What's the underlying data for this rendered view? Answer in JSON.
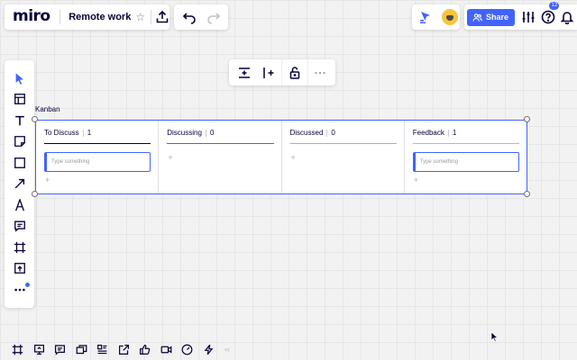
{
  "topbar": {
    "logo": "miro",
    "board_title": "Remote work",
    "star": "☆",
    "share_label": "Share",
    "notifications_count": "12"
  },
  "kanban": {
    "label": "Kanban",
    "columns": [
      {
        "title": "To Discuss",
        "count": "1",
        "color": "#050038",
        "cards": [
          "Type something"
        ]
      },
      {
        "title": "Discussing",
        "count": "0",
        "color": "#4262ff",
        "cards": []
      },
      {
        "title": "Discussed",
        "count": "0",
        "color": "#8fd14f",
        "cards": []
      },
      {
        "title": "Feedback",
        "count": "1",
        "color": "#b7b7c2",
        "cards": [
          "Type something"
        ]
      }
    ],
    "add_symbol": "+"
  },
  "bottom_bar": {
    "collapse_symbol": "‹‹"
  },
  "colors": {
    "accent": "#4262ff",
    "canvas": "#f2f2f2"
  }
}
